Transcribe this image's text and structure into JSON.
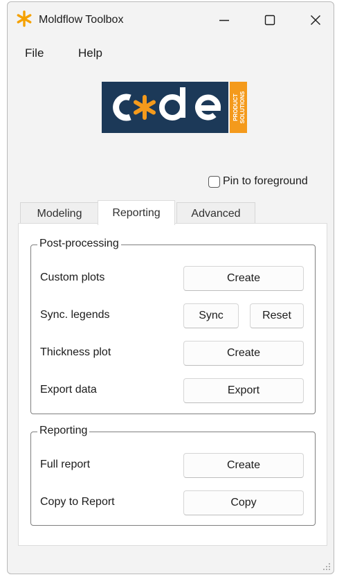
{
  "window": {
    "title": "Moldflow Toolbox",
    "icon": "star-icon",
    "accent_color": "#f5a100"
  },
  "menu": {
    "file": "File",
    "help": "Help"
  },
  "logo": {
    "text": "code",
    "side_text_1": "PRODUCT",
    "side_text_2": "SOLUTIONS",
    "bg_color": "#1c3958",
    "accent_color": "#f49a1c"
  },
  "pin": {
    "label": "Pin to foreground",
    "checked": false
  },
  "tabs": [
    {
      "label": "Modeling",
      "active": false
    },
    {
      "label": "Reporting",
      "active": true
    },
    {
      "label": "Advanced",
      "active": false
    }
  ],
  "post_processing": {
    "title": "Post-processing",
    "rows": [
      {
        "label": "Custom plots",
        "button": "Create"
      },
      {
        "label": "Sync. legends",
        "button": "Sync",
        "button2": "Reset"
      },
      {
        "label": "Thickness plot",
        "button": "Create"
      },
      {
        "label": "Export data",
        "button": "Export"
      }
    ]
  },
  "reporting": {
    "title": "Reporting",
    "rows": [
      {
        "label": "Full report",
        "button": "Create"
      },
      {
        "label": "Copy to Report",
        "button": "Copy"
      }
    ]
  }
}
